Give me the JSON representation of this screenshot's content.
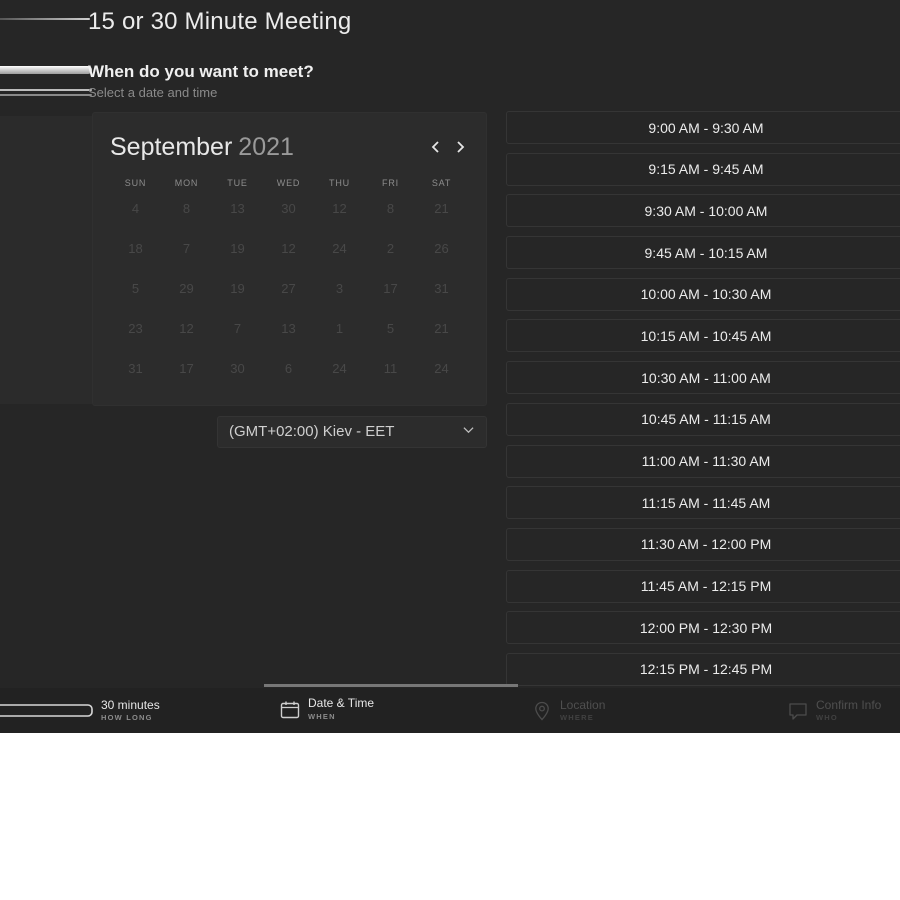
{
  "page": {
    "title": "15 or 30 Minute Meeting",
    "heading": "When do you want to meet?",
    "subheading": "Select a date and time"
  },
  "calendar": {
    "month": "September",
    "year": "2021",
    "weekdays": [
      "SUN",
      "MON",
      "TUE",
      "WED",
      "THU",
      "FRI",
      "SAT"
    ],
    "weeks": [
      [
        "4",
        "8",
        "13",
        "30",
        "12",
        "8",
        "21"
      ],
      [
        "18",
        "7",
        "19",
        "12",
        "24",
        "2",
        "26"
      ],
      [
        "5",
        "29",
        "19",
        "27",
        "3",
        "17",
        "31"
      ],
      [
        "23",
        "12",
        "7",
        "13",
        "1",
        "5",
        "21"
      ],
      [
        "31",
        "17",
        "30",
        "6",
        "24",
        "11",
        "24"
      ]
    ]
  },
  "timezone": {
    "label": "(GMT+02:00) Kiev - EET"
  },
  "slots": [
    "9:00 AM - 9:30 AM",
    "9:15 AM - 9:45 AM",
    "9:30 AM - 10:00 AM",
    "9:45 AM - 10:15 AM",
    "10:00 AM - 10:30 AM",
    "10:15 AM - 10:45 AM",
    "10:30 AM - 11:00 AM",
    "10:45 AM - 11:15 AM",
    "11:00 AM - 11:30 AM",
    "11:15 AM - 11:45 AM",
    "11:30 AM - 12:00 PM",
    "11:45 AM - 12:15 PM",
    "12:00 PM - 12:30 PM",
    "12:15 PM - 12:45 PM"
  ],
  "steps": [
    {
      "label": "30 minutes",
      "sublabel": "HOW LONG",
      "icon": "duration-bar-icon",
      "state": "done"
    },
    {
      "label": "Date & Time",
      "sublabel": "WHEN",
      "icon": "calendar-icon",
      "state": "active"
    },
    {
      "label": "Location",
      "sublabel": "WHERE",
      "icon": "location-pin-icon",
      "state": "pending"
    },
    {
      "label": "Confirm Info",
      "sublabel": "WHO",
      "icon": "chat-icon",
      "state": "pending"
    }
  ],
  "colors": {
    "background": "#262626",
    "text": "#ececec",
    "muted": "#8a8a8a",
    "disabled": "#484848"
  }
}
